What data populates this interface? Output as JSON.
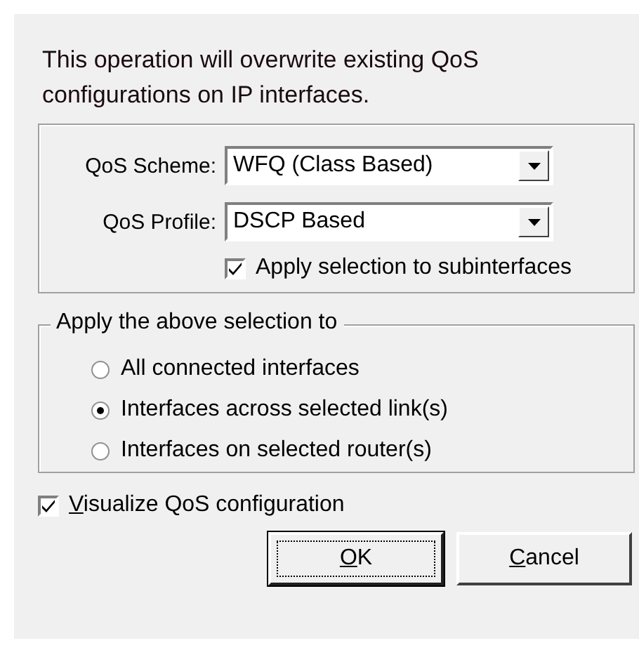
{
  "message": "This operation will overwrite existing QoS configurations on IP interfaces.",
  "settings": {
    "fields": [
      {
        "label": "QoS Scheme:",
        "value": "WFQ (Class Based)"
      },
      {
        "label": "QoS Profile:",
        "value": "DSCP Based"
      }
    ],
    "subinterfaces": {
      "label": "Apply selection to subinterfaces",
      "checked": true
    }
  },
  "apply_group": {
    "legend": "Apply the above selection to",
    "options": [
      {
        "label": "All connected interfaces",
        "selected": false
      },
      {
        "label": "Interfaces across selected link(s)",
        "selected": true
      },
      {
        "label": "Interfaces on selected router(s)",
        "selected": false
      }
    ]
  },
  "visualize": {
    "label": "Visualize QoS configuration",
    "first_letter_underlined": true,
    "checked": true
  },
  "buttons": [
    {
      "label": "OK",
      "first_letter_underlined": true,
      "focused": true
    },
    {
      "label": "Cancel",
      "first_letter_underlined": true,
      "focused": false
    }
  ]
}
